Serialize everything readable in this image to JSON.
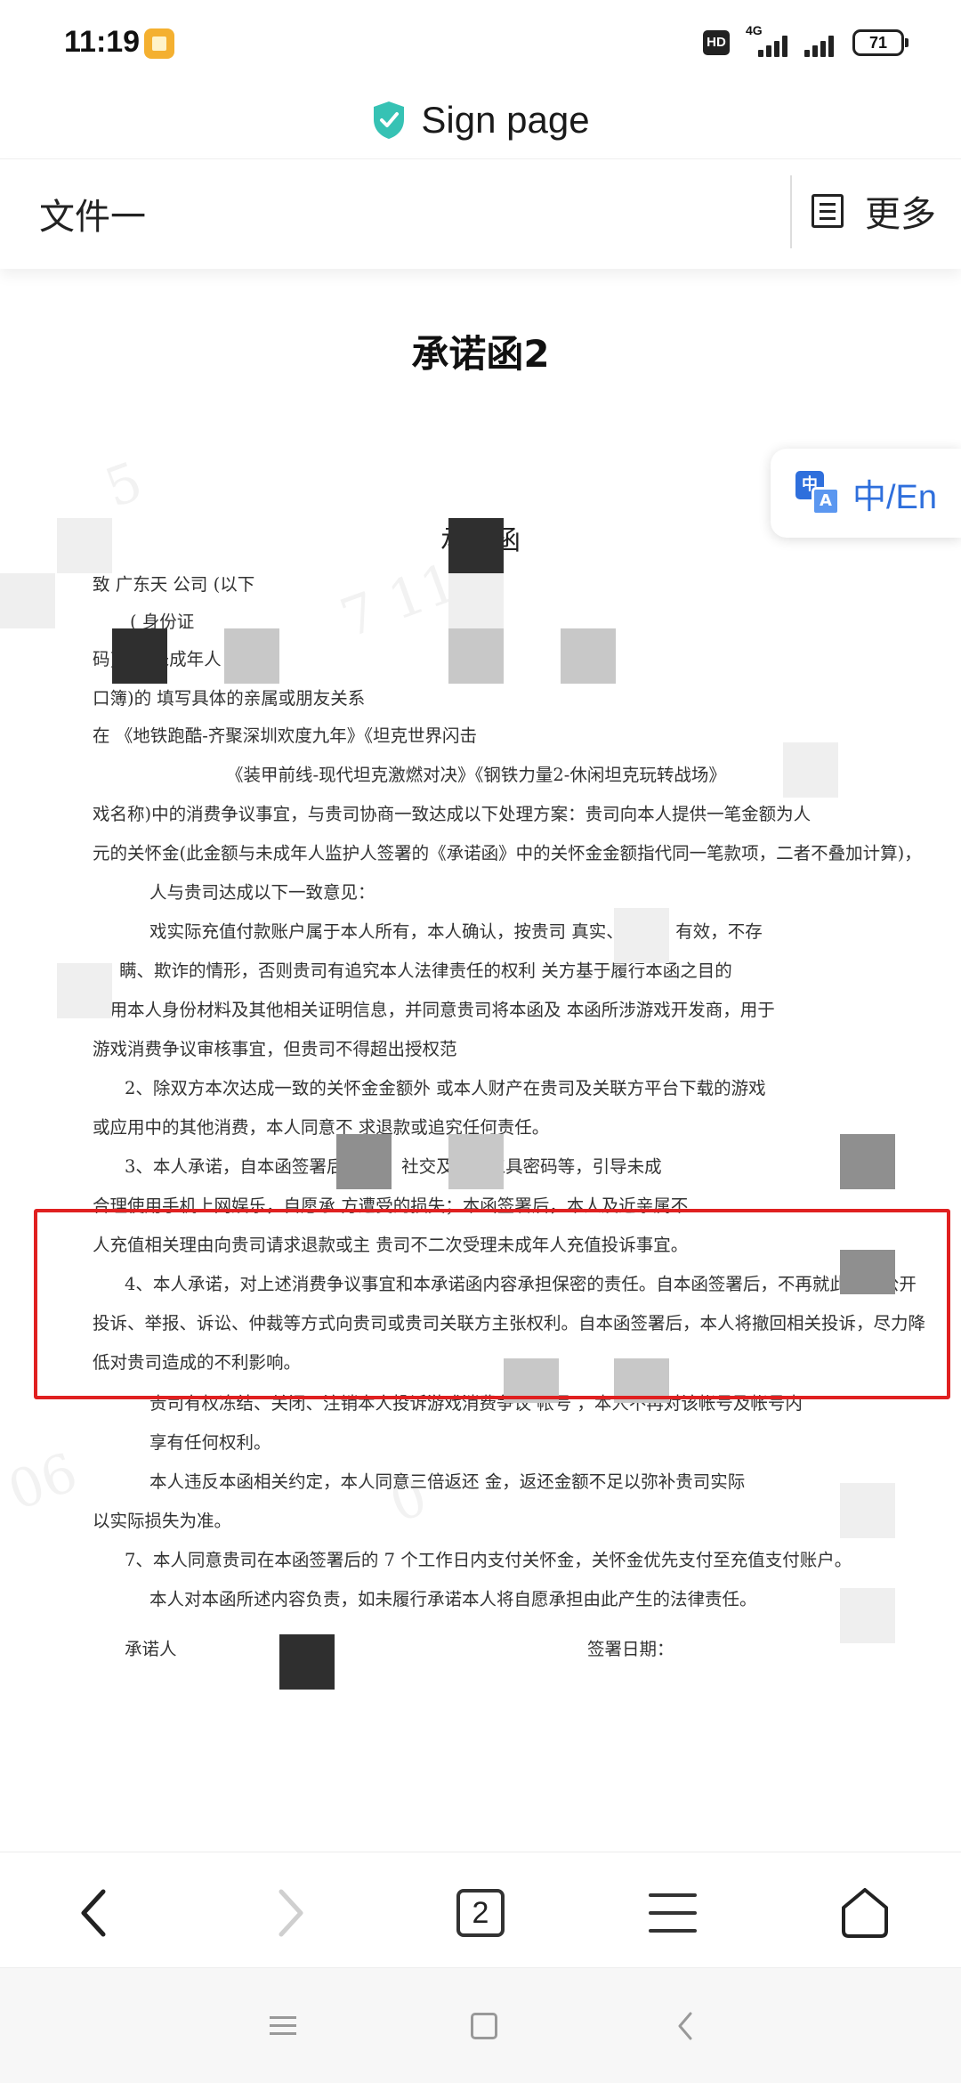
{
  "status_bar": {
    "time": "11:19",
    "hd": "HD",
    "network": "4G",
    "battery": "71"
  },
  "title_bar": {
    "title": "Sign page"
  },
  "doc_header": {
    "name": "文件一",
    "more_label": "更多"
  },
  "document": {
    "heading": "承诺函2",
    "translate_label": "中/En",
    "translate_icon_top": "中",
    "translate_icon_bottom": "A",
    "scan": {
      "title": "承诺函",
      "lines": [
        "致 广东天          公司 (以下",
        "                        (                                                   身份证",
        "码),系                         (未成年人",
        "口簿)的                填写具体的亲属或朋友关系",
        "在                    《地铁跑酷-齐聚深圳欢度九年》《坦克世界闪击",
        "《装甲前线-现代坦克激燃对决》《钢铁力量2-休闲坦克玩转战场》",
        "戏名称)中的消费争议事宜，与贵司协商一致达成以下处理方案：贵司向本人提供一笔金额为人",
        "元的关怀金(此金额与未成年人监护人签署的《承诺函》中的关怀金金额指代同一笔款项，二者不叠加计算)，",
        "人与贵司达成以下一致意见：",
        "戏实际充值付款账户属于本人所有，本人确认，按贵司                              真实、合法、有效，不存",
        "瞒、欺诈的情形，否则贵司有追究本人法律责任的权利                              关方基于履行本函之目的",
        "使用本人身份材料及其他相关证明信息，并同意贵司将本函及                          本函所涉游戏开发商，用于",
        "游戏消费争议审核事宜，但贵司不得超出授权范",
        "2、除双方本次达成一致的关怀金金额外                                              或本人财产在贵司及关联方平台下载的游戏",
        "或应用中的其他消费，本人同意不                                              求退款或追究任何责任。",
        "3、本人承诺，自本函签署后                              帐号、社交及支付工具密码等，引导未成",
        "合理使用手机上网娱乐，自愿承                              方遭受的损失；本函签署后，本人及近亲属不",
        "人充值相关理由向贵司请求退款或主                  贵司不二次受理未成年人充值投诉事宜。",
        "4、本人承诺，对上述消费争议事宜和本承诺函内容承担保密的责任。自本函签署后，不再就此事以公开",
        "投诉、举报、诉讼、仲裁等方式向贵司或贵司关联方主张权利。自本函签署后，本人将撤回相关投诉，尽力降",
        "低对贵司造成的不利影响。",
        "贵司有权冻结、关闭、注销本人投诉游戏消费争议                  帐号                  ，本人不再对该帐号及帐号内",
        "享有任何权利。",
        "本人违反本函相关约定，本人同意三倍返还                              金，返还金额不足以弥补贵司实际",
        "以实际损失为准。",
        "7、本人同意贵司在本函签署后的 7 个工作日内支付关怀金，关怀金优先支付至充值支付账户。",
        "本人对本函所述内容负责，如未履行承诺本人将自愿承担由此产生的法律责任。",
        "承诺人",
        "签署日期："
      ]
    }
  },
  "bottom_nav": {
    "tab_count": "2"
  }
}
